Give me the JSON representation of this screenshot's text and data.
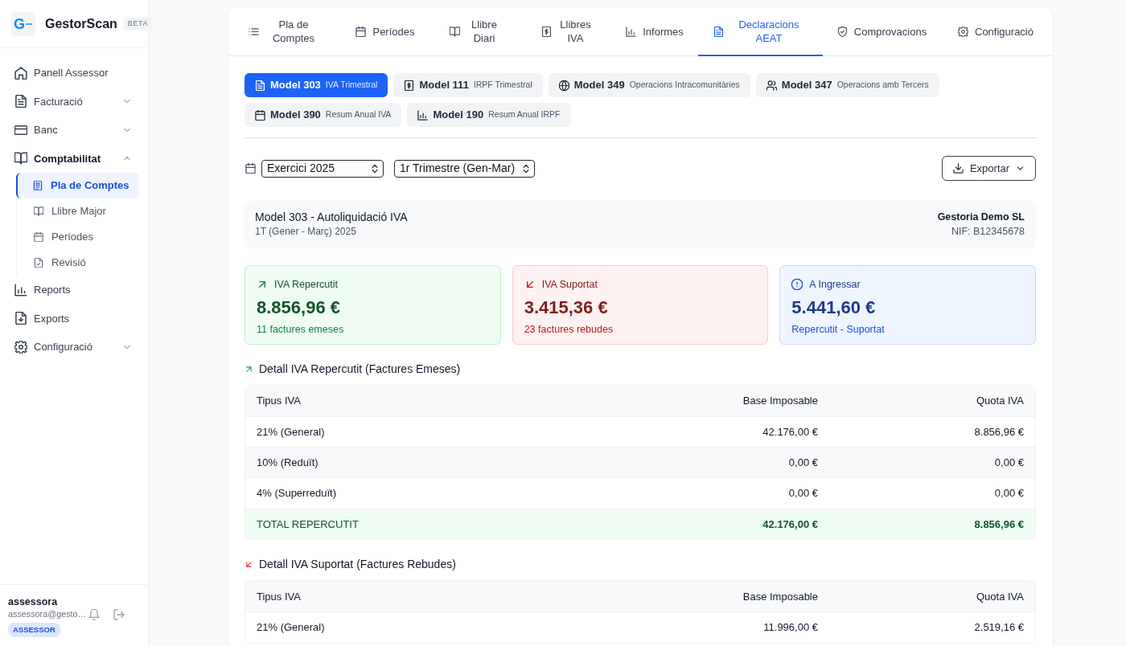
{
  "sidebar": {
    "brand": {
      "logo": "G",
      "name": "GestorScan",
      "badge": "BETA"
    },
    "items": [
      {
        "kind": "link",
        "label": "Panell Assessor",
        "selected": false
      },
      {
        "kind": "group",
        "label": "Facturació",
        "selected": false,
        "expanded": false
      },
      {
        "kind": "group",
        "label": "Banc",
        "selected": false,
        "expanded": false
      },
      {
        "kind": "group",
        "label": "Comptabilitat",
        "selected": false,
        "expanded": true,
        "children": [
          {
            "label": "Pla de Comptes",
            "selected": true
          },
          {
            "label": "Llibre Major",
            "selected": false
          },
          {
            "label": "Períodes",
            "selected": false
          },
          {
            "label": "Revisió",
            "selected": false
          }
        ]
      },
      {
        "kind": "link",
        "label": "Reports",
        "selected": false
      },
      {
        "kind": "link",
        "label": "Exports",
        "selected": false
      },
      {
        "kind": "group",
        "label": "Configuració",
        "selected": false,
        "expanded": false
      }
    ],
    "user": {
      "name": "assessora",
      "email": "assessora@gesto…",
      "role": "ASSESSOR"
    }
  },
  "tabs": [
    {
      "label": "Pla de Comptes",
      "selected": false
    },
    {
      "label": "Períodes",
      "selected": false
    },
    {
      "label": "Llibre Diari",
      "selected": false
    },
    {
      "label": "Llibres IVA",
      "selected": false
    },
    {
      "label": "Informes",
      "selected": false
    },
    {
      "label": "Declaracions AEAT",
      "selected": true
    },
    {
      "label": "Comprovacions",
      "selected": false
    },
    {
      "label": "Configuració",
      "selected": false
    }
  ],
  "models": [
    {
      "code": "Model 303",
      "description": "IVA Trimestral",
      "selected": true
    },
    {
      "code": "Model 111",
      "description": "IRPF Trimestral",
      "selected": false
    },
    {
      "code": "Model 349",
      "description": "Operacions Intracomunitàries",
      "selected": false
    },
    {
      "code": "Model 347",
      "description": "Operacions amb Tercers",
      "selected": false
    },
    {
      "code": "Model 390",
      "description": "Resum Anual IVA",
      "selected": false
    },
    {
      "code": "Model 190",
      "description": "Resum Anual IRPF",
      "selected": false
    }
  ],
  "filters": {
    "year": "Exercici 2025",
    "period": "1r Trimestre (Gen-Mar)",
    "export": "Exportar"
  },
  "summary": {
    "title": "Model 303 - Autoliquidació IVA",
    "period": "1T (Gener - Març) 2025",
    "company": "Gestoria Demo SL",
    "nif": "NIF: B12345678"
  },
  "stats": [
    {
      "kind": "income",
      "label": "IVA Repercutit",
      "value": "8.856,96 €",
      "note": "11 factures emeses"
    },
    {
      "kind": "expense",
      "label": "IVA Suportat",
      "value": "3.415,36 €",
      "note": "23 factures rebudes"
    },
    {
      "kind": "balance",
      "label": "A Ingressar",
      "value": "5.441,60 €",
      "note": "Repercutit - Suportat"
    }
  ],
  "sections": [
    {
      "kind": "income",
      "title": "Detall IVA Repercutit (Factures Emeses)",
      "columns": [
        "Tipus IVA",
        "Base Imposable",
        "Quota IVA"
      ],
      "rows": [
        {
          "kind": "item",
          "cells": [
            "21% (General)",
            "42.176,00 €",
            "8.856,96 €"
          ]
        },
        {
          "kind": "item",
          "cells": [
            "10% (Reduït)",
            "0,00 €",
            "0,00 €"
          ]
        },
        {
          "kind": "item",
          "cells": [
            "4% (Superreduït)",
            "0,00 €",
            "0,00 €"
          ]
        },
        {
          "kind": "total",
          "cells": [
            "TOTAL REPERCUTIT",
            "42.176,00 €",
            "8.856,96 €"
          ]
        }
      ]
    },
    {
      "kind": "expense",
      "title": "Detall IVA Suportat (Factures Rebudes)",
      "columns": [
        "Tipus IVA",
        "Base Imposable",
        "Quota IVA"
      ],
      "rows": [
        {
          "kind": "item",
          "cells": [
            "21% (General)",
            "11.996,00 €",
            "2.519,16 €"
          ]
        }
      ]
    }
  ]
}
